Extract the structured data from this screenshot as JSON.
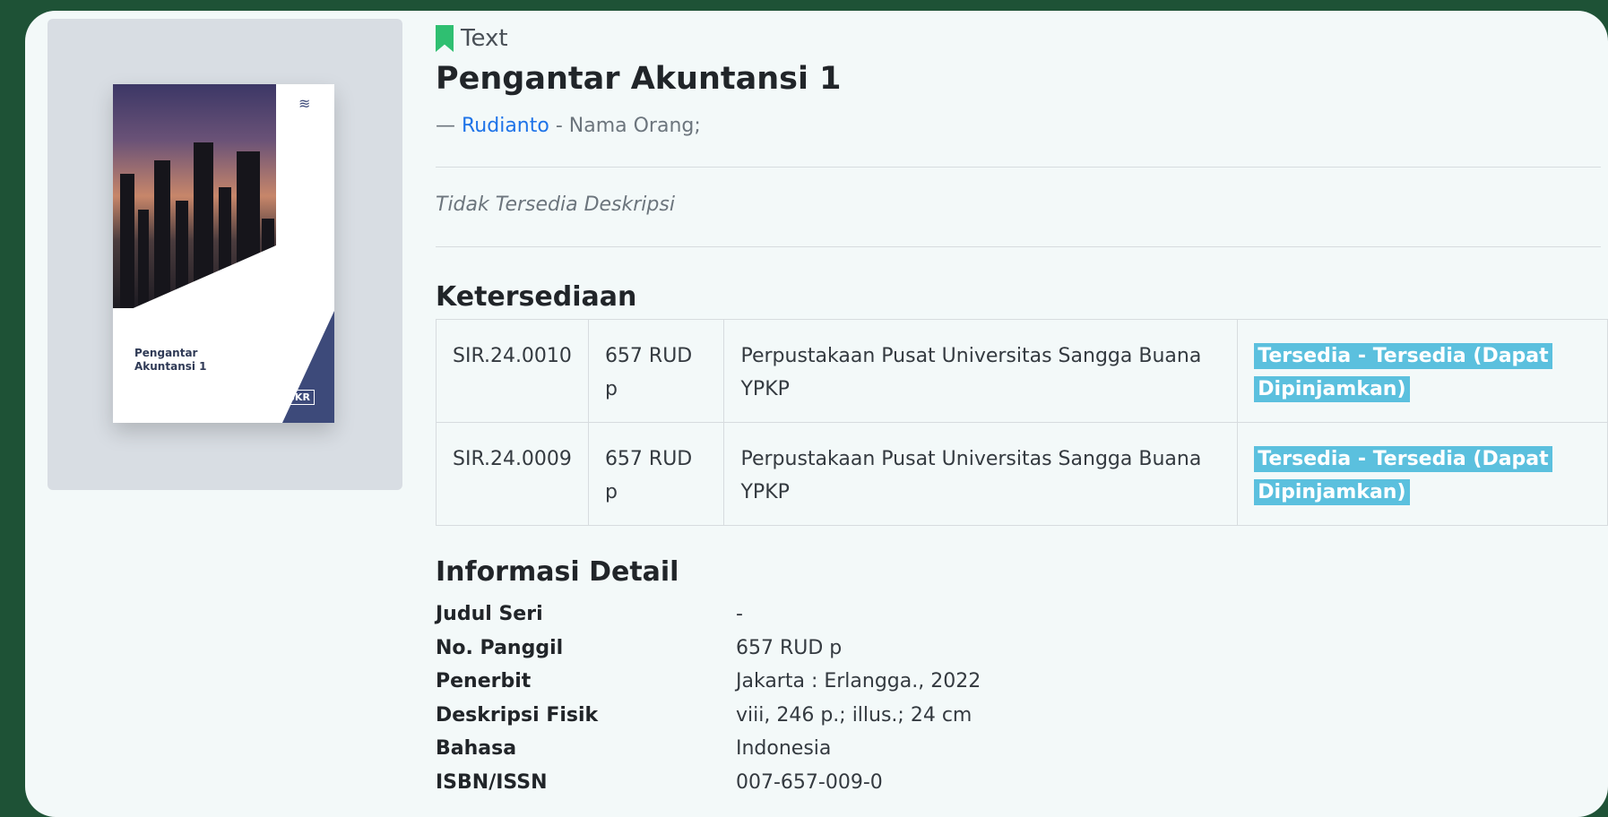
{
  "record": {
    "type_label": "Text",
    "title": "Pengantar Akuntansi 1",
    "author_prefix": "—",
    "author_name": "Rudianto",
    "author_role": "- Nama Orang;",
    "description": "Tidak Tersedia Deskripsi"
  },
  "cover": {
    "title_line1": "Pengantar",
    "title_line2": "Akuntansi 1",
    "publisher_mark": "SKR"
  },
  "availability": {
    "heading": "Ketersediaan",
    "rows": [
      {
        "item_code": "SIR.24.0010",
        "call_number": "657 RUD p",
        "location": "Perpustakaan Pusat Universitas Sangga Buana YPKP",
        "status": "Tersedia - Tersedia (Dapat Dipinjamkan)"
      },
      {
        "item_code": "SIR.24.0009",
        "call_number": "657 RUD p",
        "location": "Perpustakaan Pusat Universitas Sangga Buana YPKP",
        "status": "Tersedia - Tersedia (Dapat Dipinjamkan)"
      }
    ]
  },
  "detail": {
    "heading": "Informasi Detail",
    "rows": [
      {
        "label": "Judul Seri",
        "value": "-"
      },
      {
        "label": "No. Panggil",
        "value": "657 RUD p"
      },
      {
        "label": "Penerbit",
        "value": "Jakarta : Erlangga., 2022"
      },
      {
        "label": "Deskripsi Fisik",
        "value": "viii, 246 p.; illus.; 24 cm"
      },
      {
        "label": "Bahasa",
        "value": "Indonesia"
      },
      {
        "label": "ISBN/ISSN",
        "value": "007-657-009-0"
      }
    ]
  },
  "colors": {
    "page_background": "#1e5236",
    "card_background": "#f3f9f9",
    "link": "#1e73e8",
    "badge": "#5bc0de",
    "bookmark_icon": "#2fbf71"
  }
}
